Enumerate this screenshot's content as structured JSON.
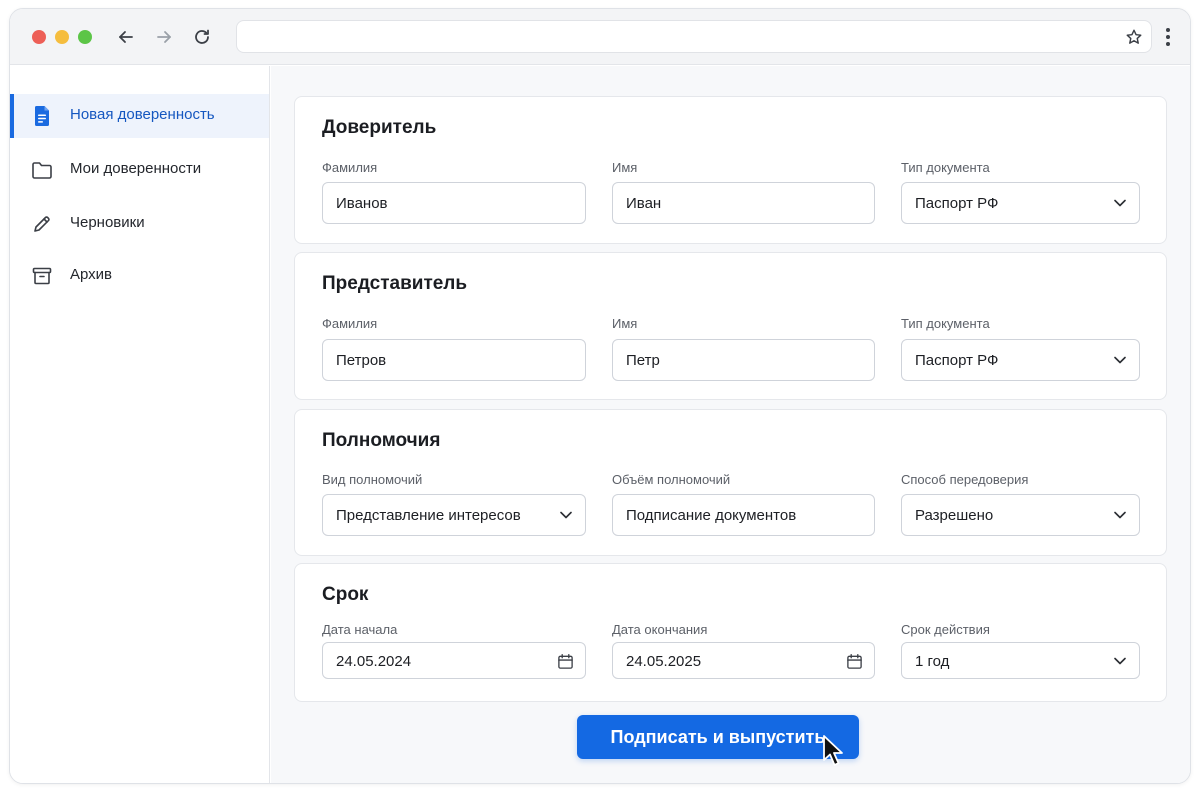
{
  "browser": {
    "address_value": "",
    "address_placeholder": ""
  },
  "sidebar": {
    "items": [
      {
        "label": "Новая доверенность",
        "icon": "document-icon",
        "active": true
      },
      {
        "label": "Мои доверенности",
        "icon": "folder-icon",
        "active": false
      },
      {
        "label": "Черновики",
        "icon": "pencil-icon",
        "active": false
      },
      {
        "label": "Архив",
        "icon": "archive-box-icon",
        "active": false
      }
    ]
  },
  "form": {
    "principal": {
      "title": "Доверитель",
      "surname_label": "Фамилия",
      "surname_value": "Иванов",
      "name_label": "Имя",
      "name_value": "Иван",
      "doc_label": "Тип документа",
      "doc_value": "Паспорт РФ"
    },
    "representative": {
      "title": "Представитель",
      "surname_label": "Фамилия",
      "surname_value": "Петров",
      "name_label": "Имя",
      "name_value": "Петр",
      "doc_label": "Тип документа",
      "doc_value": "Паспорт РФ"
    },
    "powers": {
      "title": "Полномочия",
      "kind_label": "Вид полномочий",
      "kind_value": "Представление интересов",
      "scope_label": "Объём полномочий",
      "scope_value": "Подписание документов",
      "redelegation_label": "Способ передоверия",
      "redelegation_value": "Разрешено"
    },
    "term": {
      "title": "Срок",
      "start_label": "Дата начала",
      "start_value": "24.05.2024",
      "end_label": "Дата окончания",
      "end_value": "24.05.2025",
      "duration_label": "Срок действия",
      "duration_value": "1 год"
    },
    "submit_label": "Подписать и выпустить"
  },
  "colors": {
    "accent": "#1469e3",
    "active_bg": "#eef3fc",
    "window_red": "#ed5f57",
    "window_yellow": "#f5bd3e",
    "window_green": "#5cc547"
  }
}
